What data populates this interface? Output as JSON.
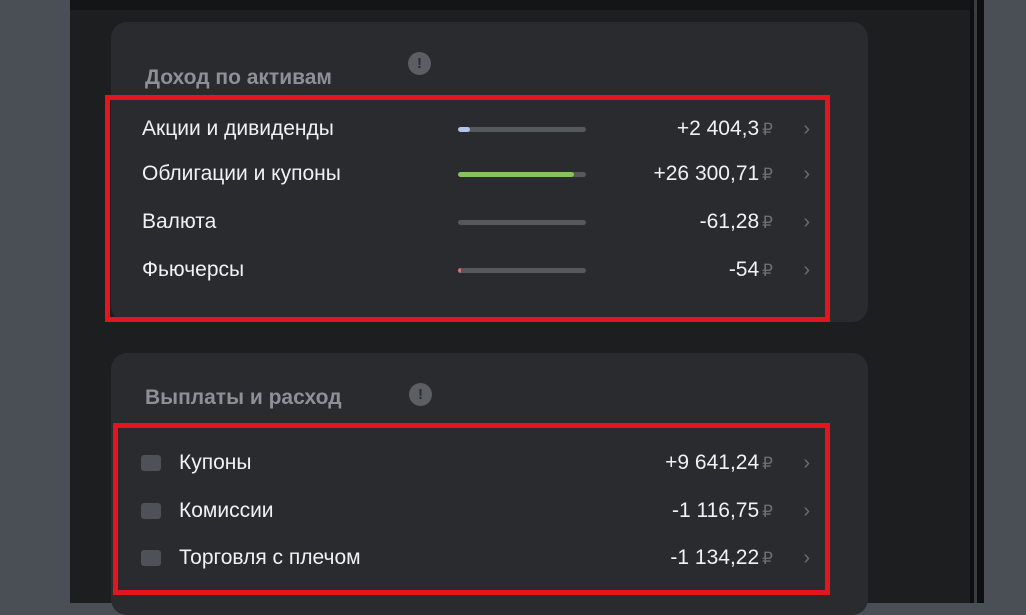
{
  "income_card": {
    "title": "Доход по активам",
    "info_symbol": "!",
    "rows": [
      {
        "label": "Акции и дивиденды",
        "value": "+2 404,3",
        "currency": "₽",
        "bar_fraction": 0.09,
        "bar_color": "#b6c3ea"
      },
      {
        "label": "Облигации и купоны",
        "value": "+26 300,71",
        "currency": "₽",
        "bar_fraction": 0.91,
        "bar_color": "#86c25e"
      },
      {
        "label": "Валюта",
        "value": "-61,28",
        "currency": "₽",
        "bar_fraction": 0.0,
        "bar_color": "#e06c6c"
      },
      {
        "label": "Фьючерсы",
        "value": "-54",
        "currency": "₽",
        "bar_fraction": 0.01,
        "bar_color": "#e06c6c"
      }
    ]
  },
  "payouts_card": {
    "title": "Выплаты и расход",
    "info_symbol": "!",
    "rows": [
      {
        "label": "Купоны",
        "value": "+9 641,24",
        "currency": "₽",
        "icon": "coupons-icon"
      },
      {
        "label": "Комиссии",
        "value": "-1 116,75",
        "currency": "₽",
        "icon": "commissions-icon"
      },
      {
        "label": "Торговля с плечом",
        "value": "-1 134,22",
        "currency": "₽",
        "icon": "leverage-icon"
      }
    ]
  },
  "chevron_symbol": "›",
  "colors": {
    "highlight": "#e3161f",
    "card_bg": "#2a2b2e",
    "panel_bg": "#1d1e20"
  }
}
